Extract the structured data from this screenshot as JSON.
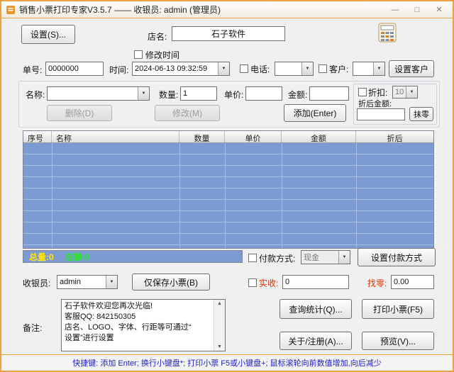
{
  "window": {
    "title": "销售小票打印专家V3.5.7 —— 收银员: admin (管理员)",
    "minimize": "—",
    "maximize": "□",
    "close": "✕"
  },
  "top": {
    "settings_button": "设置(S)...",
    "store_label": "店名:",
    "store_name": "石子软件",
    "modify_time_label": "修改时间"
  },
  "order_row": {
    "order_label": "单号:",
    "order_value": "0000000",
    "time_label": "时间:",
    "time_value": "2024-06-13 09:32:59",
    "phone_label": "电话:",
    "phone_value": "",
    "customer_label": "客户:",
    "customer_value": "",
    "set_customer_button": "设置客户"
  },
  "entry": {
    "name_label": "名称:",
    "name_value": "",
    "qty_label": "数量:",
    "qty_value": "1",
    "price_label": "单价:",
    "price_value": "",
    "amount_label": "金额:",
    "amount_value": "",
    "delete_button": "删除(D)",
    "modify_button": "修改(M)",
    "add_button": "添加(Enter)",
    "discount": {
      "label": "折扣:",
      "value": "10",
      "after_label": "折后金额:",
      "after_value": "",
      "round_button": "抹零"
    }
  },
  "grid": {
    "headers": [
      "序号",
      "名称",
      "数量",
      "单价",
      "金额",
      "折后"
    ],
    "rows": []
  },
  "totals": {
    "qty_text": "总量:0",
    "amount_text": "总额:0"
  },
  "payment": {
    "label": "付款方式:",
    "value": "现金",
    "set_button": "设置付款方式"
  },
  "cashier": {
    "label": "收银员:",
    "value": "admin",
    "save_button": "仅保存小票(B)",
    "received_label": "实收:",
    "received_value": "0",
    "change_label": "找零:",
    "change_value": "0.00"
  },
  "remarks": {
    "label": "备注:",
    "text": "石子软件欢迎您再次光临!\n客服QQ: 842150305\n店名、LOGO、字体、行距等可通过“\n设置”进行设置"
  },
  "actions": {
    "query_button": "查询统计(Q)...",
    "print_button": "打印小票(F5)",
    "about_button": "关于/注册(A)...",
    "preview_button": "预览(V)..."
  },
  "statusbar": {
    "text": "快捷键: 添加 Enter; 换行小键盘*; 打印小票 F5或小键盘+; 鼠标滚轮向前数值增加,向后减少"
  },
  "colors": {
    "frame": "#eda13f",
    "grid_blue": "#7d9bd3",
    "total_qty": "#ffe400",
    "total_amount": "#2ae62a",
    "alert_red": "#e03000",
    "status_text": "#1b1bd0"
  }
}
